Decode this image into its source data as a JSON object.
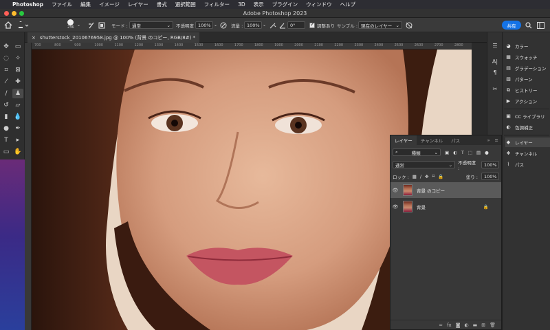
{
  "menubar": {
    "app": "Photoshop",
    "items": [
      "ファイル",
      "編集",
      "イメージ",
      "レイヤー",
      "書式",
      "選択範囲",
      "フィルター",
      "3D",
      "表示",
      "プラグイン",
      "ウィンドウ",
      "ヘルプ"
    ]
  },
  "window": {
    "title": "Adobe Photoshop 2023"
  },
  "options": {
    "brush_size": "236",
    "mode_label": "モード :",
    "mode_value": "通常",
    "opacity_label": "不透明度 :",
    "opacity_value": "100%",
    "flow_label": "流量 :",
    "flow_value": "100%",
    "angle_value": "0°",
    "aligned_label": "調整あり",
    "sample_label": "サンプル :",
    "sample_value": "現在のレイヤー",
    "share_label": "共有"
  },
  "document": {
    "tab_title": "shutterstock_2010676958.jpg @ 100% (背景 のコピー, RGB/8#) *",
    "ruler_ticks": [
      "700",
      "800",
      "900",
      "1000",
      "1100",
      "1200",
      "1300",
      "1400",
      "1500",
      "1600",
      "1700",
      "1800",
      "1900",
      "2000",
      "2100",
      "2200",
      "2300",
      "2400",
      "2500",
      "2600",
      "2700",
      "2800"
    ]
  },
  "right_panels": {
    "group1": [
      "カラー",
      "スウォッチ",
      "グラデーション",
      "パターン",
      "ヒストリー",
      "アクション"
    ],
    "group2": [
      "CC ライブラリ",
      "色調補正"
    ],
    "group3": [
      "レイヤー",
      "チャンネル",
      "パス"
    ]
  },
  "layers_panel": {
    "tabs": [
      "レイヤー",
      "チャンネル",
      "パス"
    ],
    "filter_kind": "種類",
    "blend_mode": "通常",
    "opacity_label": "不透明度 :",
    "opacity_value": "100%",
    "lock_label": "ロック :",
    "fill_label": "塗り :",
    "fill_value": "100%",
    "layers": [
      {
        "name": "背景 のコピー",
        "selected": true
      },
      {
        "name": "背景",
        "locked": true
      }
    ]
  }
}
